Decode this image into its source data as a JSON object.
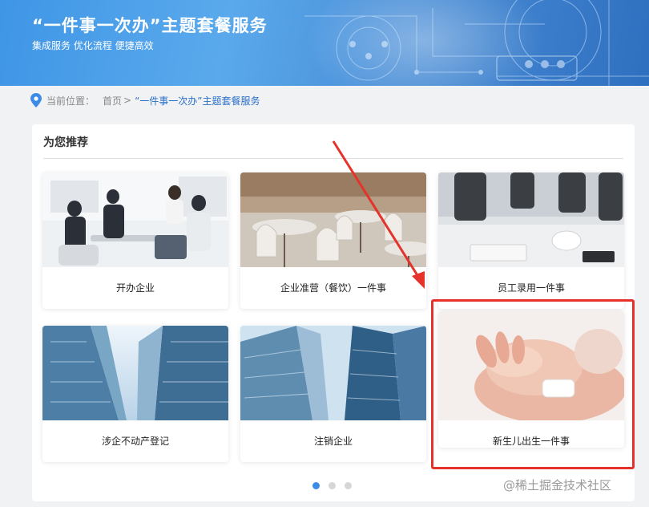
{
  "banner": {
    "title": "“一件事一次办”主题套餐服务",
    "subtitle": "集成服务 优化流程 便捷高效"
  },
  "breadcrumb": {
    "icon": "location-pin-icon",
    "prefix": "当前位置：",
    "home": "首页",
    "separator": ">",
    "current": "“一件事一次办”主题套餐服务"
  },
  "recommend": {
    "title": "为您推荐",
    "cards": [
      {
        "label": "开办企业"
      },
      {
        "label": "企业准营（餐饮）一件事"
      },
      {
        "label": "员工录用一件事"
      },
      {
        "label": "涉企不动产登记"
      },
      {
        "label": "注销企业"
      },
      {
        "label": "新生儿出生一件事"
      }
    ],
    "highlighted_card": "新生儿出生一件事"
  },
  "pagination": {
    "pages": 3,
    "active": 1
  },
  "watermark": "@稀土掘金技术社区",
  "colors": {
    "annotation": "#e5322b",
    "accent": "#3c8be6",
    "banner": "#4a8fd8"
  }
}
